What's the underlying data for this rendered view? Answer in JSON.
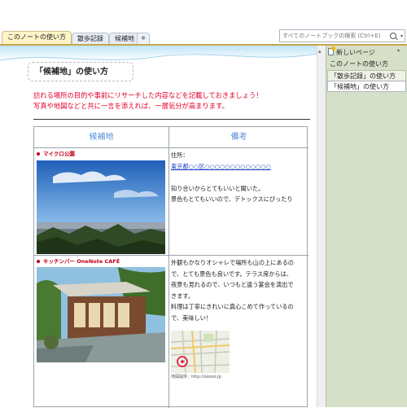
{
  "tabs": [
    {
      "label": "このノートの使い方",
      "active": true
    },
    {
      "label": "散歩記録",
      "active": false
    },
    {
      "label": "候補地",
      "active": false
    }
  ],
  "search": {
    "placeholder": "すべてのノートブックの検索 (Ctrl+E)"
  },
  "page": {
    "title": "「候補地」の使い方",
    "intro": [
      "訪れる場所の目的や事前にリサーチした内容などを記載しておきましょう！",
      "写真や地図などと共に一言を添えれば、一層気分が高まります。"
    ]
  },
  "table": {
    "headers": [
      "候補地",
      "備考"
    ],
    "rows": [
      {
        "place": "マイクロ公園",
        "notes": [
          "住所：",
          "東京都○○区○○○○○○○○○○○○○",
          "",
          "知り合いからとてもいいと聞いた。",
          "景色もとてもいいので、デトックスにぴったり"
        ]
      },
      {
        "place": "キッチンバー OneNote CAFÉ",
        "notes": [
          "外観もかなりオシャレで場所も山の上にあるの",
          "で、とても景色も良いです。テラス席からは、",
          "夜景も見れるので、いつもと違う宴会を演出で",
          "きます。",
          "料理は丁寧にきれいに真心こめて作っているの",
          "で、美味しい！"
        ],
        "map_caption": "地図提供：http://ooooo.jp"
      }
    ]
  },
  "navpane": {
    "new_page": "新しいページ",
    "items": [
      "このノートの使い方",
      "「散歩記録」の使い方",
      "「候補地」の使い方"
    ],
    "selected_index": 2
  },
  "colors": {
    "intro_text": "#e4002b",
    "header_text": "#4f8fd8",
    "place_label": "#c00018",
    "link": "#1a3fc4",
    "nav_background": "#d6e0c8"
  }
}
